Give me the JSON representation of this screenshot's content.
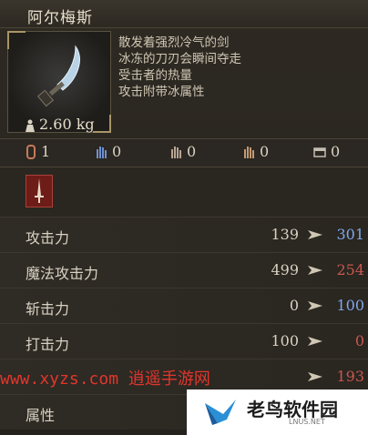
{
  "title": "阿尔梅斯",
  "weight": "2.60 kg",
  "description": [
    "散发着强烈冷气的剑",
    "冰冻的刀刃会瞬间夺走",
    "受击者的热量",
    "攻击附带冰属性"
  ],
  "requirements": [
    {
      "icon": "strength-icon",
      "value": "1"
    },
    {
      "icon": "dexterity-icon",
      "value": "0"
    },
    {
      "icon": "intelligence-icon",
      "value": "0"
    },
    {
      "icon": "faith-icon",
      "value": "0"
    },
    {
      "icon": "arcane-icon",
      "value": "0"
    }
  ],
  "stats": [
    {
      "label": "攻击力",
      "old": "139",
      "new": "301",
      "trend": "up"
    },
    {
      "label": "魔法攻击力",
      "old": "499",
      "new": "254",
      "trend": "down"
    },
    {
      "label": "斩击力",
      "old": "0",
      "new": "100",
      "trend": "up"
    },
    {
      "label": "打击力",
      "old": "100",
      "new": "0",
      "trend": "down"
    },
    {
      "label": "",
      "old": "",
      "new": "193",
      "trend": "down"
    },
    {
      "label": "属性",
      "old": "",
      "new": "",
      "trend": ""
    }
  ],
  "watermark": {
    "url": "www.xyzs.com",
    "cn": "逍遥手游网"
  },
  "logo": {
    "text": "老鸟软件园",
    "sub": "LNUS.NET"
  },
  "colors": {
    "up": "#7ea7e8",
    "down": "#c9574e",
    "watermark": "#e2362c"
  }
}
